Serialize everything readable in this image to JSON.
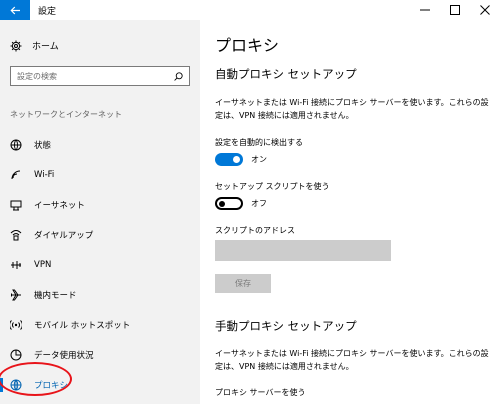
{
  "window": {
    "title": "設定",
    "back_icon": "back-arrow-icon",
    "controls": [
      "minimize-icon",
      "maximize-icon",
      "close-icon"
    ]
  },
  "nav": {
    "home_label": "ホーム",
    "search_placeholder": "設定の検索",
    "section_label": "ネットワークとインターネット",
    "items": [
      {
        "label": "状態",
        "icon": "globe-status-icon"
      },
      {
        "label": "Wi-Fi",
        "icon": "wifi-icon"
      },
      {
        "label": "イーサネット",
        "icon": "ethernet-icon"
      },
      {
        "label": "ダイヤルアップ",
        "icon": "dialup-icon"
      },
      {
        "label": "VPN",
        "icon": "vpn-icon"
      },
      {
        "label": "機内モード",
        "icon": "airplane-icon"
      },
      {
        "label": "モバイル ホットスポット",
        "icon": "hotspot-icon"
      },
      {
        "label": "データ使用状況",
        "icon": "data-usage-icon"
      },
      {
        "label": "プロキシ",
        "icon": "globe-icon",
        "active": true
      }
    ],
    "accent_color": "#0078d7",
    "highlight_color": "#e8141a"
  },
  "main": {
    "title": "プロキシ",
    "auto_section": {
      "title": "自動プロキシ セットアップ",
      "description": "イーサネットまたは Wi-Fi 接続にプロキシ サーバーを使います。これらの設定は、VPN 接続には適用されません。",
      "auto_detect_label": "設定を自動的に検出する",
      "auto_detect_state": "オン",
      "script_label": "セットアップ スクリプトを使う",
      "script_state": "オフ",
      "address_label": "スクリプトのアドレス",
      "address_value": "",
      "save_label": "保存"
    },
    "manual_section": {
      "title": "手動プロキシ セットアップ",
      "description": "イーサネットまたは Wi-Fi 接続にプロキシ サーバーを使います。これらの設定は、VPN 接続には適用されません。",
      "use_proxy_label": "プロキシ サーバーを使う"
    }
  }
}
